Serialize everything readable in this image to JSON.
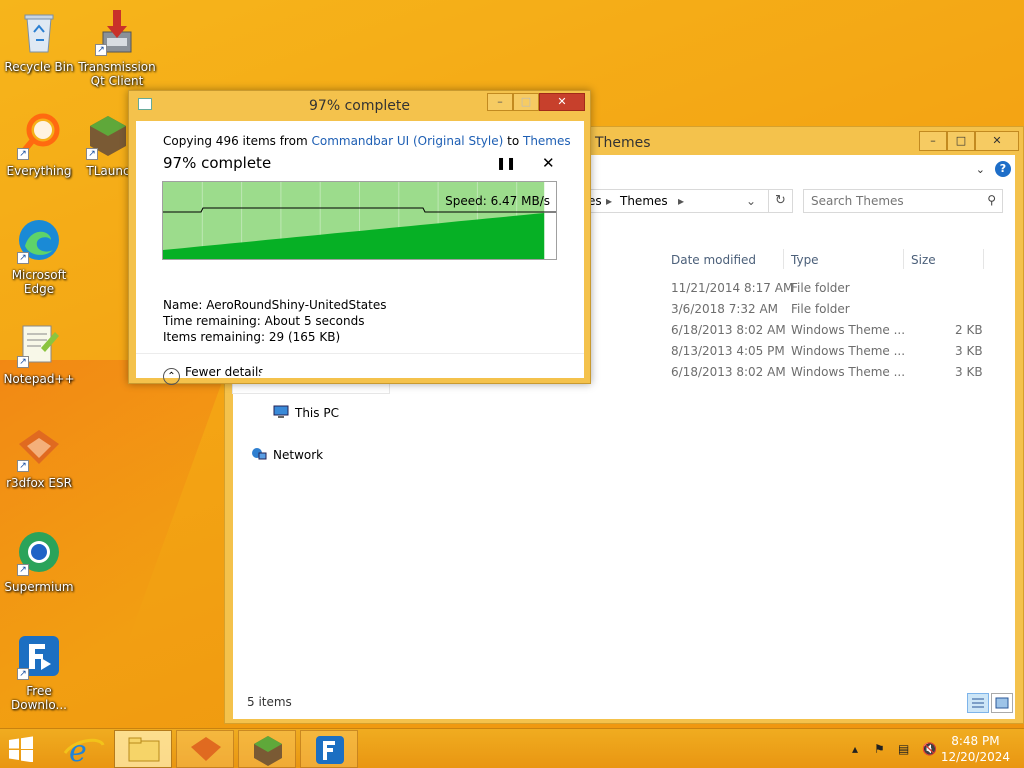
{
  "desktop": {
    "icons": [
      {
        "label": "Recycle Bin",
        "icon": "recycle-bin-icon"
      },
      {
        "label": "Transmission Qt Client",
        "icon": "transmission-icon"
      },
      {
        "label": "Everything",
        "icon": "everything-search-icon"
      },
      {
        "label": "TLaunc",
        "icon": "tlauncher-icon"
      },
      {
        "label": "Microsoft Edge",
        "icon": "edge-icon"
      },
      {
        "label": "Notepad++",
        "icon": "notepad-plus-plus-icon"
      },
      {
        "label": "r3dfox ESR",
        "icon": "r3dfox-icon"
      },
      {
        "label": "Supermium",
        "icon": "supermium-icon"
      },
      {
        "label": "Free Downlo...",
        "icon": "free-download-manager-icon"
      }
    ]
  },
  "explorer": {
    "title": "Themes",
    "breadcrumb_partial": "es",
    "breadcrumb_current": "Themes",
    "search_placeholder": "Search Themes",
    "columns": [
      "Date modified",
      "Type",
      "Size"
    ],
    "rows": [
      {
        "date": "11/21/2014 8:17 AM",
        "type": "File folder",
        "size": ""
      },
      {
        "date": "3/6/2018 7:32 AM",
        "type": "File folder",
        "size": ""
      },
      {
        "date": "6/18/2013 8:02 AM",
        "type": "Windows Theme ...",
        "size": "2 KB"
      },
      {
        "date": "8/13/2013 4:05 PM",
        "type": "Windows Theme ...",
        "size": "3 KB"
      },
      {
        "date": "6/18/2013 8:02 AM",
        "type": "Windows Theme ...",
        "size": "3 KB"
      }
    ],
    "nav": {
      "this_pc": "This PC",
      "network": "Network"
    },
    "status": "5 items"
  },
  "copy_dialog": {
    "title": "97% complete",
    "copy_prefix": "Copying 496 items from",
    "source": "Commandbar UI (Original Style)",
    "to_word": "to",
    "destination": "Themes",
    "percent_text": "97% complete",
    "progress": 0.97,
    "speed": "Speed: 6.47 MB/s",
    "name_label": "Name:",
    "name_value": "AeroRoundShiny-UnitedStates",
    "time_label": "Time remaining:",
    "time_value": "About 5 seconds",
    "items_label": "Items remaining:",
    "items_value": "29 (165 KB)",
    "fewer_details": "Fewer details"
  },
  "taskbar": {
    "clock_time": "8:48 PM",
    "clock_date": "12/20/2024"
  },
  "colors": {
    "accent_gold": "#f4c24c",
    "progress_green": "#06b025",
    "progress_fill": "#9cdc8c",
    "link_blue": "#1e5fb4",
    "close_red": "#c7402c"
  }
}
